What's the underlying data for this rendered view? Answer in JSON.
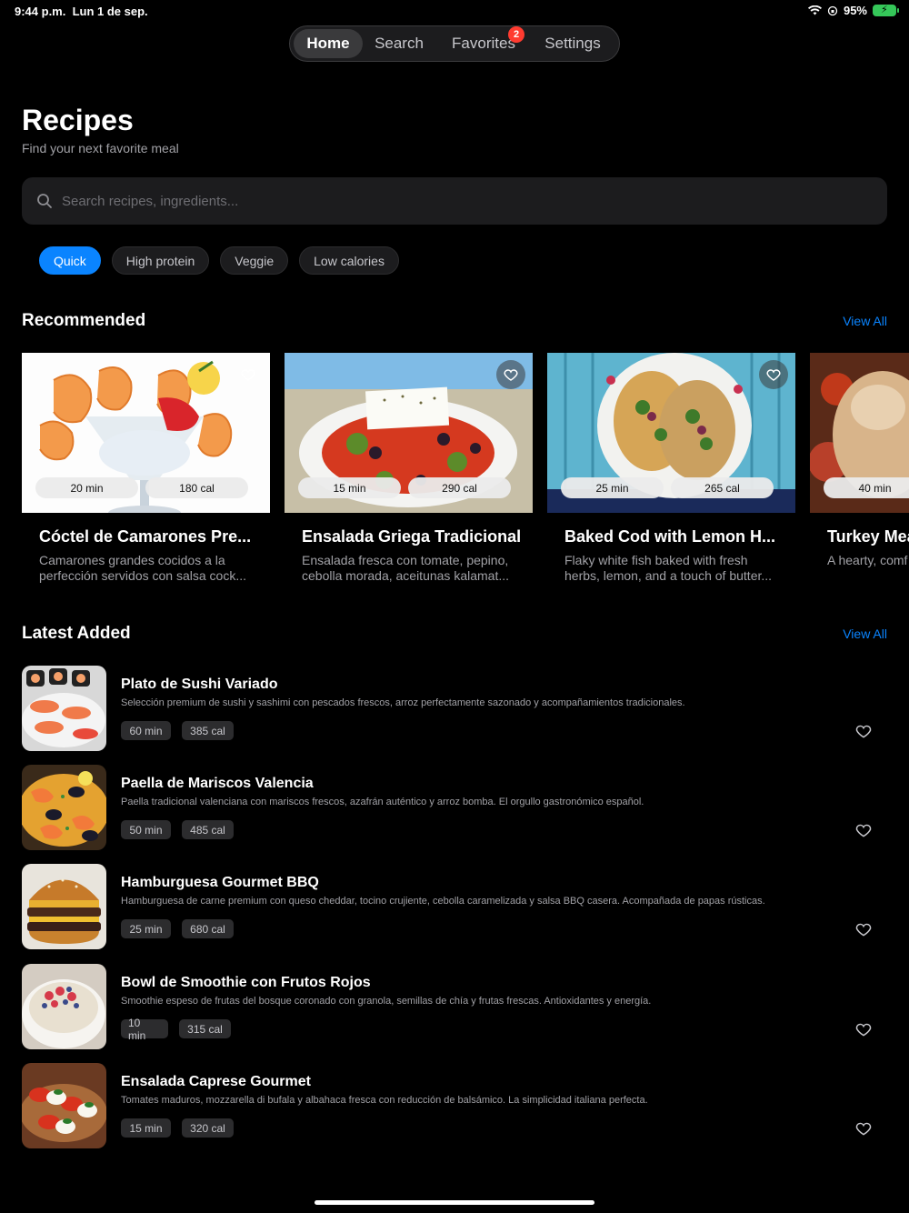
{
  "status": {
    "time": "9:44 p.m.",
    "date": "Lun 1 de sep.",
    "battery": "95%"
  },
  "tabs": [
    {
      "label": "Home",
      "active": true
    },
    {
      "label": "Search",
      "active": false
    },
    {
      "label": "Favorites",
      "badge": "2",
      "active": false
    },
    {
      "label": "Settings",
      "active": false
    }
  ],
  "header": {
    "title": "Recipes",
    "subtitle": "Find your next favorite meal"
  },
  "search": {
    "placeholder": "Search recipes, ingredients..."
  },
  "filters": [
    {
      "label": "Quick",
      "active": true
    },
    {
      "label": "High protein",
      "active": false
    },
    {
      "label": "Veggie",
      "active": false
    },
    {
      "label": "Low calories",
      "active": false
    }
  ],
  "recommended": {
    "title": "Recommended",
    "view_all": "View All",
    "cards": [
      {
        "title": "Cóctel de Camarones Pre...",
        "desc": "Camarones grandes cocidos a la perfección servidos con salsa cock...",
        "time": "20 min",
        "cal": "180 cal"
      },
      {
        "title": "Ensalada Griega Tradicional",
        "desc": "Ensalada fresca con tomate, pepino, cebolla morada, aceitunas kalamat...",
        "time": "15 min",
        "cal": "290 cal"
      },
      {
        "title": "Baked Cod with Lemon H...",
        "desc": "Flaky white fish baked with fresh herbs, lemon, and a touch of butter...",
        "time": "25 min",
        "cal": "265 cal"
      },
      {
        "title": "Turkey Mea",
        "desc": "A hearty, comf turkey meatba",
        "time": "40 min",
        "cal": ""
      }
    ]
  },
  "latest": {
    "title": "Latest Added",
    "view_all": "View All",
    "items": [
      {
        "title": "Plato de Sushi Variado",
        "desc": "Selección premium de sushi y sashimi con pescados frescos, arroz perfectamente sazonado y acompañamientos tradicionales.",
        "time": "60 min",
        "cal": "385 cal"
      },
      {
        "title": "Paella de Mariscos Valencia",
        "desc": "Paella tradicional valenciana con mariscos frescos, azafrán auténtico y arroz bomba. El orgullo gastronómico español.",
        "time": "50 min",
        "cal": "485 cal"
      },
      {
        "title": "Hamburguesa Gourmet BBQ",
        "desc": "Hamburguesa de carne premium con queso cheddar, tocino crujiente, cebolla caramelizada y salsa BBQ casera. Acompañada de papas rústicas.",
        "time": "25 min",
        "cal": "680 cal"
      },
      {
        "title": "Bowl de Smoothie con Frutos Rojos",
        "desc": "Smoothie espeso de frutas del bosque coronado con granola, semillas de chía y frutas frescas. Antioxidantes y energía.",
        "time": "10 min",
        "cal": "315 cal"
      },
      {
        "title": "Ensalada Caprese Gourmet",
        "desc": "Tomates maduros, mozzarella di bufala y albahaca fresca con reducción de balsámico. La simplicidad italiana perfecta.",
        "time": "15 min",
        "cal": "320 cal"
      }
    ]
  },
  "colors": {
    "accent": "#0a84ff",
    "background": "#000000",
    "badge": "#ff3b30"
  }
}
